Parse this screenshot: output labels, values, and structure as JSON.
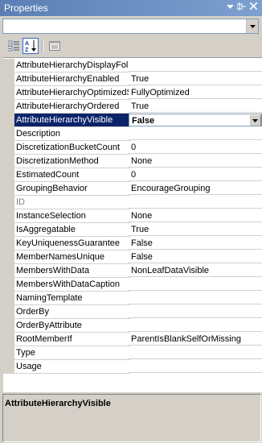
{
  "window": {
    "title": "Properties"
  },
  "combo": {
    "value": ""
  },
  "toolbar": {
    "categorized_icon": "categorized-icon",
    "alphabetical_icon": "alphabetical-sort-icon",
    "property_pages_icon": "property-pages-icon"
  },
  "properties": [
    {
      "name": "AttributeHierarchyDisplayFolder",
      "value": ""
    },
    {
      "name": "AttributeHierarchyEnabled",
      "value": "True"
    },
    {
      "name": "AttributeHierarchyOptimizedState",
      "value": "FullyOptimized"
    },
    {
      "name": "AttributeHierarchyOrdered",
      "value": "True"
    },
    {
      "name": "AttributeHierarchyVisible",
      "value": "False"
    },
    {
      "name": "Description",
      "value": ""
    },
    {
      "name": "DiscretizationBucketCount",
      "value": "0"
    },
    {
      "name": "DiscretizationMethod",
      "value": "None"
    },
    {
      "name": "EstimatedCount",
      "value": "0"
    },
    {
      "name": "GroupingBehavior",
      "value": "EncourageGrouping"
    },
    {
      "name": "ID",
      "value": ""
    },
    {
      "name": "InstanceSelection",
      "value": "None"
    },
    {
      "name": "IsAggregatable",
      "value": "True"
    },
    {
      "name": "KeyUniquenessGuarantee",
      "value": "False"
    },
    {
      "name": "MemberNamesUnique",
      "value": "False"
    },
    {
      "name": "MembersWithData",
      "value": "NonLeafDataVisible"
    },
    {
      "name": "MembersWithDataCaption",
      "value": ""
    },
    {
      "name": "NamingTemplate",
      "value": ""
    },
    {
      "name": "OrderBy",
      "value": ""
    },
    {
      "name": "OrderByAttribute",
      "value": ""
    },
    {
      "name": "RootMemberIf",
      "value": "ParentIsBlankSelfOrMissing"
    },
    {
      "name": "Type",
      "value": ""
    },
    {
      "name": "Usage",
      "value": ""
    }
  ],
  "description": {
    "title": "AttributeHierarchyVisible"
  },
  "colors": {
    "selection": "#0a246a",
    "titlebar": "#5a7fb4",
    "panel": "#d4d0c8"
  }
}
